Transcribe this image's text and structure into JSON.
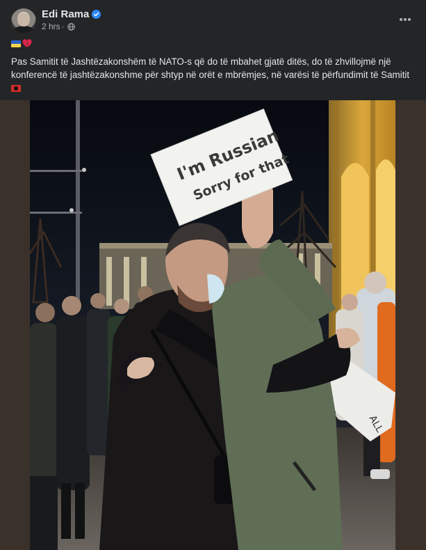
{
  "post": {
    "author": "Edi Rama",
    "timestamp": "2 hrs",
    "meta_separator": "·",
    "audience_icon": "globe-icon",
    "verified_icon": "verified-badge-icon",
    "more_icon": "more-horizontal-icon",
    "emojis": [
      "ukraine-flag-icon",
      "broken-heart-icon"
    ],
    "caption": "Pas Samitit të Jashtëzakonshëm të NATO-s që do të mbahet gjatë ditës, do të zhvillojmë një konferencë të jashtëzakonshme për shtyp në orët e mbrëmjes, në varësi të përfundimit të Samitit",
    "caption_end_emoji": "albania-flag-icon"
  },
  "photo": {
    "sign_line1": "I'm Russian",
    "sign_line2": "Sorry for that",
    "second_sign_text": "ALL"
  },
  "colors": {
    "background": "#242526",
    "text_primary": "#e4e6eb",
    "text_secondary": "#b0b3b8",
    "verified": "#2d88ff"
  }
}
